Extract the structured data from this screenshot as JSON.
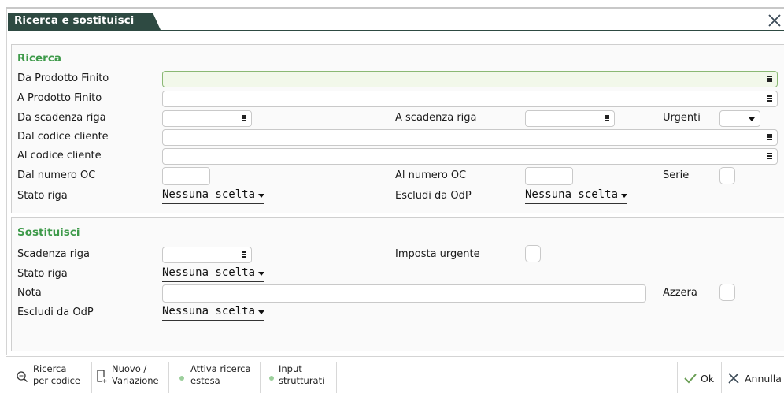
{
  "window": {
    "title": "Ricerca e sostituisci"
  },
  "ricerca": {
    "title": "Ricerca",
    "da_prodotto_finito": {
      "label": "Da Prodotto Finito",
      "value": ""
    },
    "a_prodotto_finito": {
      "label": "A Prodotto Finito",
      "value": ""
    },
    "da_scadenza_riga": {
      "label": "Da scadenza riga",
      "value": ""
    },
    "a_scadenza_riga": {
      "label": "A scadenza riga",
      "value": ""
    },
    "urgenti": {
      "label": "Urgenti",
      "value": ""
    },
    "dal_codice_cliente": {
      "label": "Dal codice cliente",
      "value": ""
    },
    "al_codice_cliente": {
      "label": "Al codice cliente",
      "value": ""
    },
    "dal_numero_oc": {
      "label": "Dal numero OC",
      "value": ""
    },
    "al_numero_oc": {
      "label": "Al numero OC",
      "value": ""
    },
    "serie": {
      "label": "Serie"
    },
    "stato_riga": {
      "label": "Stato riga",
      "value": "Nessuna scelta"
    },
    "escludi_da_odp": {
      "label": "Escludi da OdP",
      "value": "Nessuna scelta"
    }
  },
  "sostituisci": {
    "title": "Sostituisci",
    "scadenza_riga": {
      "label": "Scadenza riga",
      "value": ""
    },
    "imposta_urgente": {
      "label": "Imposta urgente"
    },
    "stato_riga": {
      "label": "Stato riga",
      "value": "Nessuna scelta"
    },
    "nota": {
      "label": "Nota",
      "value": ""
    },
    "azzera": {
      "label": "Azzera"
    },
    "escludi_da_odp": {
      "label": "Escludi da OdP",
      "value": "Nessuna scelta"
    }
  },
  "toolbar": {
    "ricerca_codice": {
      "line1": "Ricerca",
      "line2": "per codice",
      "icon": "search-icon"
    },
    "nuovo_variazione": {
      "line1": "Nuovo /",
      "line2": "Variazione",
      "icon": "new-document-icon"
    },
    "attiva_ricerca": {
      "line1": "Attiva ricerca",
      "line2": "estesa"
    },
    "input_strutturati": {
      "line1": "Input",
      "line2": "strutturati"
    },
    "ok": {
      "label": "Ok",
      "icon": "check-icon"
    },
    "annulla": {
      "label": "Annulla",
      "icon": "close-icon"
    }
  },
  "colors": {
    "title_bg": "#2e4a42",
    "section_title": "#3e9a4a",
    "active_field": "#f2f8ea"
  }
}
